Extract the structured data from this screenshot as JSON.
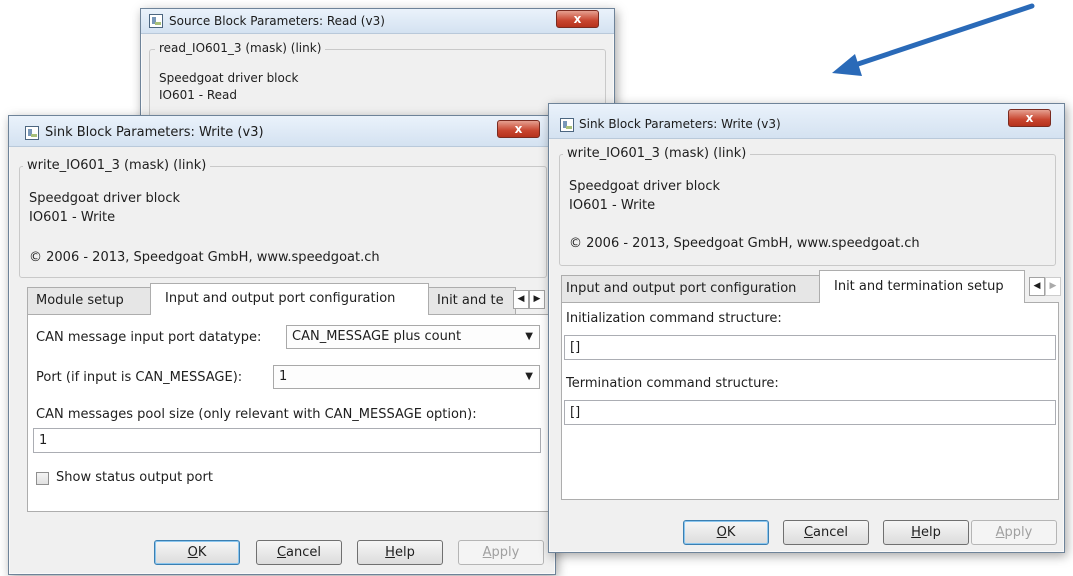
{
  "window_read": {
    "title": "Source Block Parameters: Read (v3)",
    "group_legend": "read_IO601_3 (mask) (link)",
    "desc_line1": "Speedgoat driver block",
    "desc_line2": "IO601 - Read",
    "close_label": "x"
  },
  "window_write_left": {
    "title": "Sink Block Parameters: Write (v3)",
    "close_label": "x",
    "group_legend": "write_IO601_3 (mask) (link)",
    "desc_line1": "Speedgoat driver block",
    "desc_line2": "IO601 - Write",
    "copyright": "© 2006 - 2013, Speedgoat GmbH, www.speedgoat.ch",
    "tabs": [
      {
        "label": "Module setup"
      },
      {
        "label": "Input and output port configuration"
      },
      {
        "label": "Init and te"
      }
    ],
    "can_datatype_label": "CAN message input port datatype:",
    "can_datatype_value": "CAN_MESSAGE plus count",
    "port_label": "Port (if input is CAN_MESSAGE):",
    "port_value": "1",
    "pool_label": "CAN messages pool size (only relevant with CAN_MESSAGE option):",
    "pool_value": "1",
    "status_checkbox_label": "Show status output port",
    "status_checked": false,
    "buttons": {
      "ok_u": "O",
      "ok_rest": "K",
      "cancel_u": "C",
      "cancel_rest": "ancel",
      "help_u": "H",
      "help_rest": "elp",
      "apply_u": "A",
      "apply_rest": "pply"
    }
  },
  "window_write_right": {
    "title": "Sink Block Parameters: Write (v3)",
    "close_label": "x",
    "group_legend": "write_IO601_3 (mask) (link)",
    "desc_line1": "Speedgoat driver block",
    "desc_line2": "IO601 - Write",
    "copyright": "© 2006 - 2013, Speedgoat GmbH, www.speedgoat.ch",
    "tabs": [
      {
        "label": "Input and output port configuration"
      },
      {
        "label": "Init and termination setup"
      }
    ],
    "init_label": "Initialization command structure:",
    "init_value": "[]",
    "term_label": "Termination command structure:",
    "term_value": "[]",
    "buttons": {
      "ok_u": "O",
      "ok_rest": "K",
      "cancel_u": "C",
      "cancel_rest": "ancel",
      "help_u": "H",
      "help_rest": "elp",
      "apply_u": "A",
      "apply_rest": "pply"
    }
  },
  "colors": {
    "arrow": "#2a6ab8",
    "close_button": "#c8452f"
  },
  "icons": {
    "window": "simulink-block-icon",
    "tab_scroll_left": "chevron-left-icon",
    "tab_scroll_right": "chevron-right-icon",
    "dropdown": "chevron-down-icon",
    "pointer": "arrow-icon"
  }
}
